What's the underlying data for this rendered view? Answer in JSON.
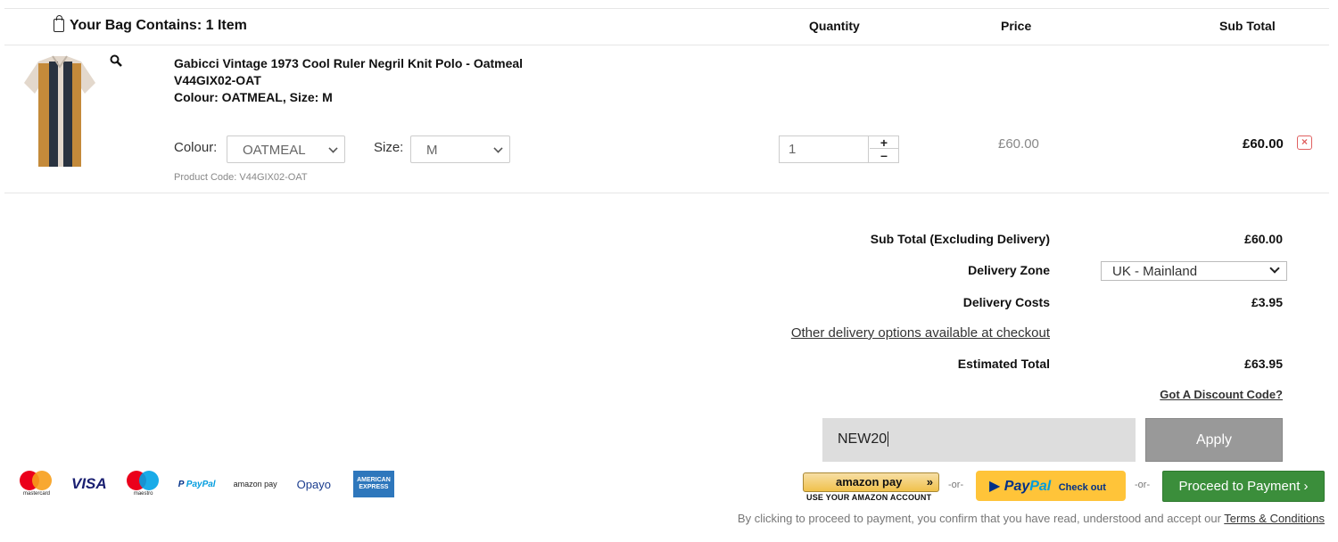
{
  "header": {
    "bag_title": "Your Bag Contains: 1 Item",
    "col_quantity": "Quantity",
    "col_price": "Price",
    "col_subtotal": "Sub Total"
  },
  "item": {
    "title": "Gabicci Vintage 1973 Cool Ruler Negril Knit Polo - Oatmeal",
    "sku": "V44GIX02-OAT",
    "variant": "Colour: OATMEAL, Size: M",
    "colour_label": "Colour:",
    "colour_value": "OATMEAL",
    "size_label": "Size:",
    "size_value": "M",
    "product_code": "Product Code: V44GIX02-OAT",
    "quantity": "1",
    "qty_plus": "+",
    "qty_minus": "–",
    "price": "£60.00",
    "line_subtotal": "£60.00",
    "remove_glyph": "×"
  },
  "summary": {
    "subtotal_label": "Sub Total (Excluding Delivery)",
    "subtotal_value": "£60.00",
    "zone_label": "Delivery Zone",
    "zone_value": "UK - Mainland",
    "delivery_label": "Delivery Costs",
    "delivery_value": "£3.95",
    "other_options_link": "Other delivery options available at checkout",
    "estimated_label": "Estimated Total",
    "estimated_value": "£63.95",
    "discount_link": "Got A Discount Code?",
    "discount_code": "NEW20",
    "apply_label": "Apply"
  },
  "payment": {
    "mastercard_label": "mastercard",
    "visa_label": "VISA",
    "maestro_label": "maestro",
    "paypal_small_a": "P",
    "paypal_small_b": "PayPal",
    "amazonpay_small": "amazon pay",
    "opayo_label": "Opayo",
    "amex_label": "AMERICAN EXPRESS",
    "amazon_btn_label": "amazon pay",
    "amazon_btn_arrows": "»",
    "amazon_btn_sub": "USE YOUR AMAZON ACCOUNT",
    "or_1": "-or-",
    "paypal_pay": "Pay",
    "paypal_pal": "Pal",
    "paypal_checkout": "Check out",
    "or_2": "-or-",
    "proceed_label": "Proceed to Payment ›"
  },
  "consent": {
    "text": "By clicking to proceed to payment, you confirm that you have read, understood and accept our ",
    "terms_link": "Terms & Conditions"
  },
  "colors": {
    "proceed_green": "#3b8e3b",
    "paypal_yellow": "#ffc439",
    "apply_grey": "#999999",
    "remove_red": "#e06060"
  }
}
